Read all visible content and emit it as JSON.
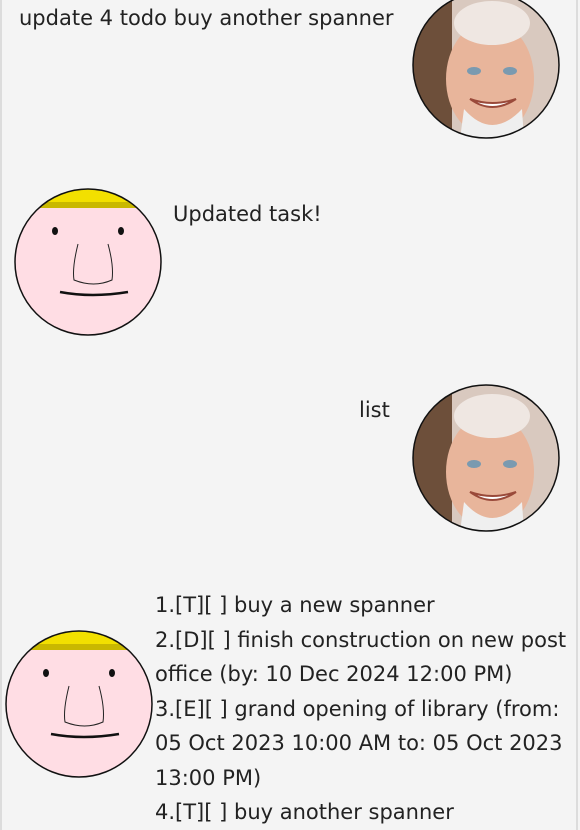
{
  "conversation": [
    {
      "sender": "user",
      "text": "update 4 todo buy another spanner"
    },
    {
      "sender": "bot",
      "text": "Updated task!"
    },
    {
      "sender": "user",
      "text": "list"
    }
  ],
  "task_list": [
    "1.[T][ ] buy a new spanner",
    "2.[D][ ] finish construction on new post",
    "office (by: 10 Dec 2024 12:00 PM)",
    "3.[E][ ] grand opening of library (from:",
    "05 Oct 2023 10:00 AM to: 05 Oct 2023",
    "13:00 PM)",
    "4.[T][ ] buy another spanner"
  ],
  "avatars": {
    "user": "user-avatar-photo-icon",
    "bot": "bot-avatar-cartoon-face-icon"
  },
  "colors": {
    "background": "#f4f4f4",
    "bot_face": "#ffdde4",
    "bot_hair": "#f2e000"
  }
}
